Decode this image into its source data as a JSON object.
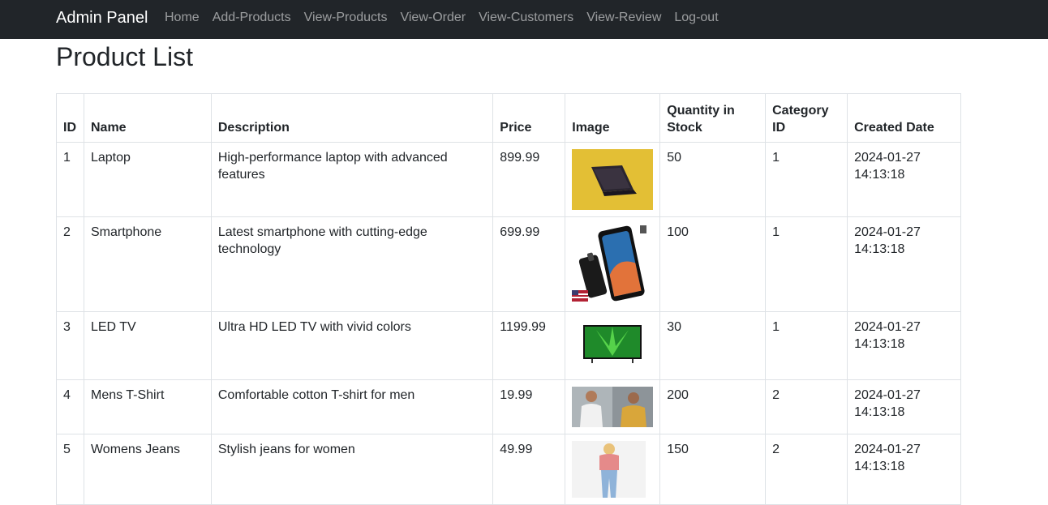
{
  "nav": {
    "brand": "Admin Panel",
    "links": [
      {
        "label": "Home"
      },
      {
        "label": "Add-Products"
      },
      {
        "label": "View-Products"
      },
      {
        "label": "View-Order"
      },
      {
        "label": "View-Customers"
      },
      {
        "label": "View-Review"
      },
      {
        "label": "Log-out"
      }
    ]
  },
  "page": {
    "title": "Product List"
  },
  "table": {
    "columns": [
      "ID",
      "Name",
      "Description",
      "Price",
      "Image",
      "Quantity in Stock",
      "Category ID",
      "Created Date"
    ],
    "rows": [
      {
        "id": "1",
        "name": "Laptop",
        "description": "High-performance laptop with advanced features",
        "price": "899.99",
        "image_icon": "laptop-image",
        "qty": "50",
        "category": "1",
        "created": "2024-01-27 14:13:18"
      },
      {
        "id": "2",
        "name": "Smartphone",
        "description": "Latest smartphone with cutting-edge technology",
        "price": "699.99",
        "image_icon": "smartphone-image",
        "qty": "100",
        "category": "1",
        "created": "2024-01-27 14:13:18"
      },
      {
        "id": "3",
        "name": "LED TV",
        "description": "Ultra HD LED TV with vivid colors",
        "price": "1199.99",
        "image_icon": "tv-image",
        "qty": "30",
        "category": "1",
        "created": "2024-01-27 14:13:18"
      },
      {
        "id": "4",
        "name": "Mens T-Shirt",
        "description": "Comfortable cotton T-shirt for men",
        "price": "19.99",
        "image_icon": "tshirt-image",
        "qty": "200",
        "category": "2",
        "created": "2024-01-27 14:13:18"
      },
      {
        "id": "5",
        "name": "Womens Jeans",
        "description": "Stylish jeans for women",
        "price": "49.99",
        "image_icon": "jeans-image",
        "qty": "150",
        "category": "2",
        "created": "2024-01-27 14:13:18"
      }
    ]
  },
  "colors": {
    "navbar_bg": "#212529",
    "brand_text": "#ffffff",
    "nav_link": "rgba(255,255,255,0.55)",
    "border": "#dee2e6",
    "text": "#212529"
  }
}
